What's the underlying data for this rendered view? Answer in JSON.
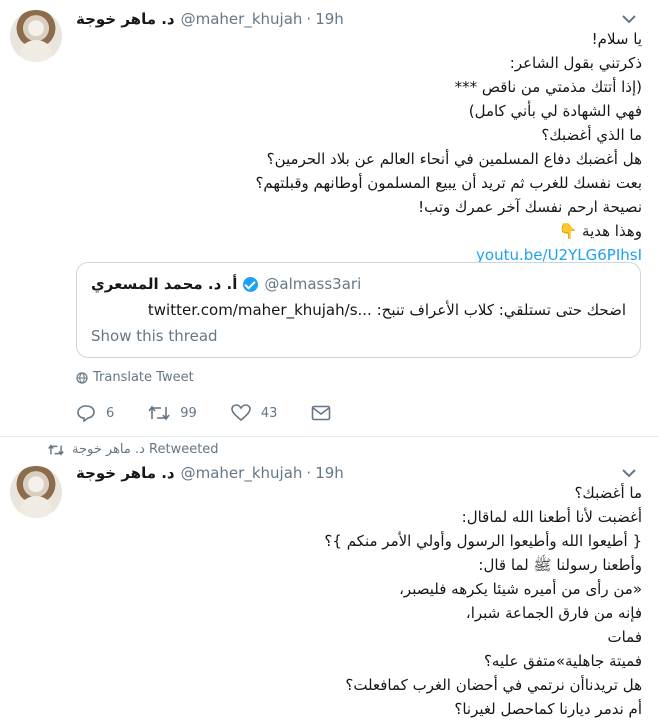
{
  "tweet1": {
    "author_name": "د. ماهر خوجة",
    "author_handle": "@maher_khujah",
    "time": "19h",
    "lines": [
      "يا سلام!",
      "ذكرتني بقول الشاعر:",
      "(إذا أتتك مذمتي من ناقص ***",
      "فهي الشهادة لي بأني كامل)",
      "ما الذي أغضبك؟",
      "هل أغضبك دفاع المسلمين في أنحاء العالم عن بلاد الحرمين؟",
      "بعت نفسك للغرب ثم تريد أن يبيع المسلمون أوطانهم وقبلتهم؟",
      "نصيحة ارحم نفسك آخر عمرك وتب!",
      "وهذا هدية 👇"
    ],
    "link": "youtu.be/U2YLG6PIhsI",
    "quote": {
      "name": "أ. د. محمد المسعري",
      "handle": "@almass3ari",
      "text": "اضحك حتى تستلقي: كلاب الأعراف تنبح: ...twitter.com/maher_khujah/s",
      "show_thread": "Show this thread"
    },
    "translate": "Translate Tweet",
    "counts": {
      "replies": "6",
      "retweets": "99",
      "likes": "43"
    }
  },
  "tweet2": {
    "retweeted_by": "د. ماهر خوجة Retweeted",
    "author_name": "د. ماهر خوجة",
    "author_handle": "@maher_khujah",
    "time": "19h",
    "lines": [
      "ما أغضبك؟",
      "أغضبت لأنا أطعنا الله لماقال:",
      "{ أطيعوا الله وأطيعوا الرسول وأولي الأمر منكم }؟",
      "وأطعنا رسولنا ﷺ لما قال:",
      "«من رأى من أميره شيئا يكرهه فليصبر،",
      "فإنه من فارق الجماعة شبرا،",
      "فمات",
      "فميتة جاهلية»متفق عليه؟",
      "هل تريدناأن نرتمي في أحضان الغرب كمافعلت؟",
      "أم ندمر ديارنا كماحصل لغيرنا؟"
    ]
  },
  "icons": {
    "caret": "chevron-down-icon",
    "globe": "globe-icon",
    "reply": "reply-icon",
    "retweet": "retweet-icon",
    "like": "heart-icon",
    "dm": "envelope-icon",
    "verified": "verified-badge-icon"
  },
  "colors": {
    "link": "#1da1f2",
    "muted": "#657786",
    "border": "#e6ecf0"
  }
}
